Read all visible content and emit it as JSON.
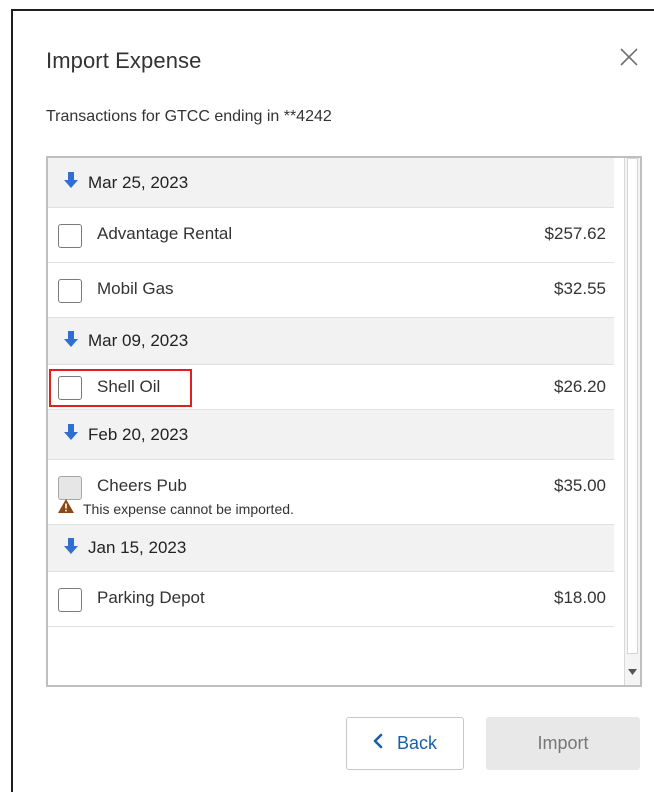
{
  "dialog": {
    "title": "Import Expense",
    "subtitle": "Transactions for GTCC ending in **4242"
  },
  "icons": {
    "close": "close-icon",
    "group": "arrow-down-icon",
    "warning": "warning-triangle-icon",
    "back": "chevron-left-icon",
    "scroll": "scroll-down-arrow-icon"
  },
  "groups": [
    {
      "date": "Mar 25, 2023",
      "items": [
        {
          "name": "Advantage Rental",
          "amount": "$257.62"
        },
        {
          "name": "Mobil Gas",
          "amount": "$32.55"
        }
      ]
    },
    {
      "date": "Mar 09, 2023",
      "items": [
        {
          "name": "Shell Oil",
          "amount": "$26.20"
        }
      ]
    },
    {
      "date": "Feb 20, 2023",
      "items": [
        {
          "name": "Cheers Pub",
          "amount": "$35.00",
          "warning": "This expense cannot be imported."
        }
      ]
    },
    {
      "date": "Jan 15, 2023",
      "items": [
        {
          "name": "Parking Depot",
          "amount": "$18.00"
        }
      ]
    }
  ],
  "buttons": {
    "back": "Back",
    "import": "Import"
  },
  "colors": {
    "accent": "#1a5ea8",
    "group_arrow": "#2f6fd1",
    "warning": "#8a4a12",
    "highlight": "#e02020"
  }
}
